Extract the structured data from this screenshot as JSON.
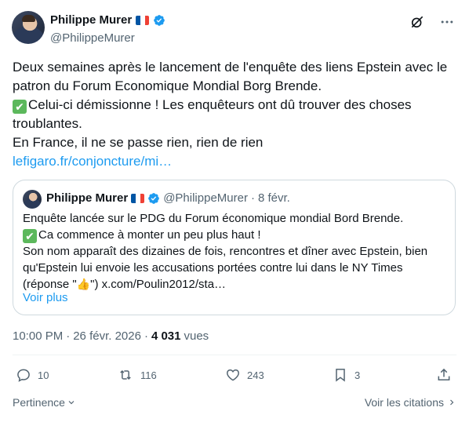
{
  "author": {
    "display_name": "Philippe Murer",
    "handle": "@PhilippeMurer",
    "flag_icon": "france-flag-icon",
    "verified_icon": "verified-badge-icon",
    "verified_color": "#1d9bf0"
  },
  "top_icons": [
    "grok-icon",
    "more-icon"
  ],
  "tweet": {
    "lines": [
      "Deux semaines après le lancement de l'enquête des liens Epstein avec le",
      "patron du Forum Economique Mondial Borg Brende.",
      "Celui-ci démissionne ! Les enquêteurs ont dû trouver des choses",
      "troublantes.",
      "En France, il ne se passe rien, rien de rien"
    ],
    "check_emoji": "✔",
    "link": "lefigaro.fr/conjoncture/mi…"
  },
  "quote": {
    "display_name": "Philippe Murer",
    "handle": "@PhilippeMurer",
    "separator": "·",
    "date": "8 févr.",
    "lines": [
      "Enquête lancée sur le PDG du Forum économique mondial Bord Brende.",
      "Ca commence à monter un peu plus haut !",
      "Son nom apparaît des dizaines de fois, rencontres et dîner avec Epstein, bien",
      "qu'Epstein lui envoie les accusations portées contre lui dans le NY Times",
      ") x.com/Poulin2012/sta…"
    ],
    "line5_prefix": "(réponse \"",
    "line5_thumb": "👍",
    "line5_mid": "\"",
    "show_more": "Voir plus"
  },
  "meta": {
    "time": "10:00 PM",
    "separator": "·",
    "date": "26 févr. 2026",
    "separator2": "·",
    "views_count": "4 031",
    "views_label": "vues"
  },
  "actions": {
    "replies": "10",
    "reposts": "116",
    "likes": "243",
    "bookmarks": "3"
  },
  "footer": {
    "relevance_label": "Pertinence",
    "quotes_label": "Voir les citations"
  },
  "colors": {
    "accent": "#1d9bf0",
    "text": "#0f1419",
    "secondary": "#536471",
    "border": "#cfd9de"
  }
}
